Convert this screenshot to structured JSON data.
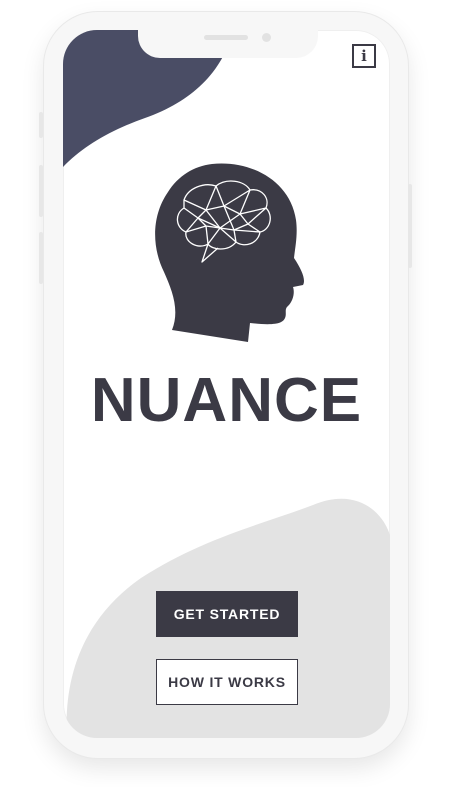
{
  "app": {
    "title": "NUANCE"
  },
  "header": {
    "info_icon": "info-icon",
    "info_label": "i"
  },
  "logo": {
    "icon": "head-brain-icon"
  },
  "actions": {
    "get_started_label": "GET STARTED",
    "how_it_works_label": "HOW IT WORKS"
  },
  "colors": {
    "primary": "#3b3a45",
    "accent_blob": "#4a4d65",
    "background_blob": "#e3e3e3",
    "surface": "#ffffff"
  }
}
